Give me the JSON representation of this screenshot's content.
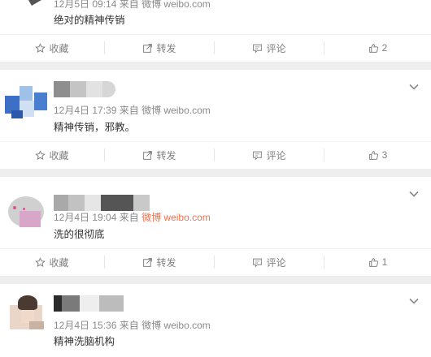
{
  "posts": [
    {
      "meta_time": "12月5日 09:14",
      "meta_from": "来自",
      "meta_src": "微博 weibo.com",
      "text": "绝对的精神传销",
      "actions": {
        "fav": "收藏",
        "repost": "转发",
        "comment": "评论",
        "like": "2"
      }
    },
    {
      "meta_time": "12月4日 17:39",
      "meta_from": "来自",
      "meta_src": "微博 weibo.com",
      "text": "精神传销，邪教。",
      "actions": {
        "fav": "收藏",
        "repost": "转发",
        "comment": "评论",
        "like": "3"
      }
    },
    {
      "meta_time": "12月4日 19:04",
      "meta_from": "来自",
      "meta_src": "微博 weibo.com",
      "text": "洗的很彻底",
      "actions": {
        "fav": "收藏",
        "repost": "转发",
        "comment": "评论",
        "like": "1"
      }
    },
    {
      "meta_time": "12月4日 15:36",
      "meta_from": "来自",
      "meta_src": "微博 weibo.com",
      "text": "精神洗脑机构"
    }
  ],
  "colors": {
    "link_orange": "#eb7350",
    "meta_gray": "#8a8a8a",
    "divider": "#eeeeee"
  },
  "icons": [
    "star-icon",
    "repost-icon",
    "comment-icon",
    "thumbs-up-icon",
    "chevron-down-icon"
  ]
}
